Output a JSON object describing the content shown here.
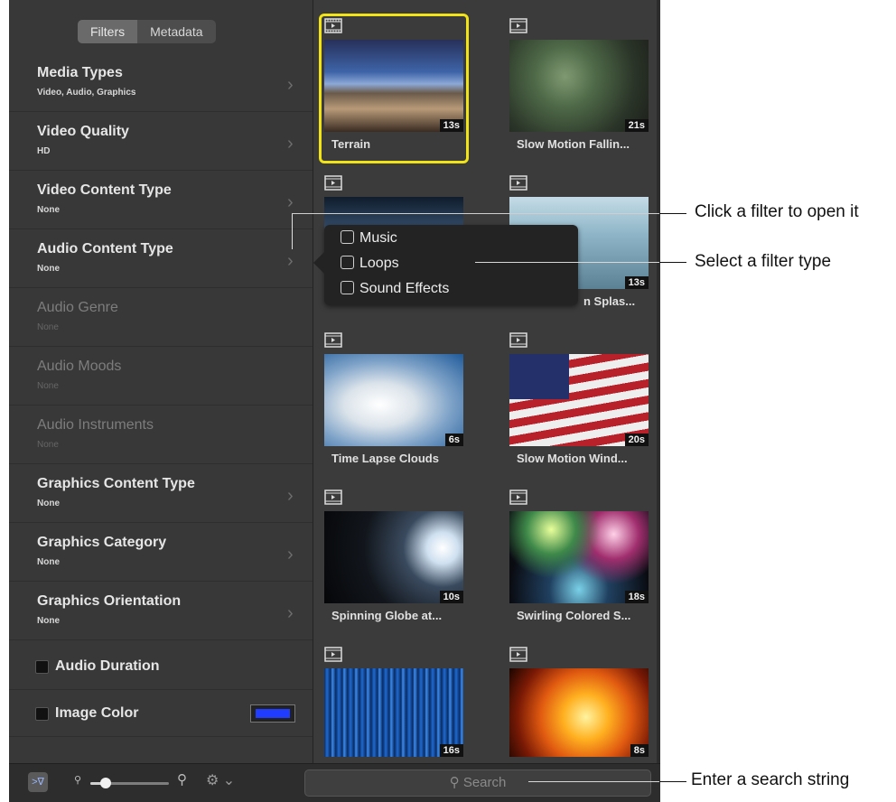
{
  "sidebar": {
    "tabs": [
      "Filters",
      "Metadata"
    ],
    "filters": [
      {
        "title": "Media Types",
        "subtitle": "Video, Audio, Graphics",
        "enabled": true
      },
      {
        "title": "Video Quality",
        "subtitle": "HD",
        "enabled": true
      },
      {
        "title": "Video Content Type",
        "subtitle": "None",
        "enabled": true
      },
      {
        "title": "Audio Content Type",
        "subtitle": "None",
        "enabled": true
      },
      {
        "title": "Audio Genre",
        "subtitle": "None",
        "enabled": false
      },
      {
        "title": "Audio Moods",
        "subtitle": "None",
        "enabled": false
      },
      {
        "title": "Audio Instruments",
        "subtitle": "None",
        "enabled": false
      },
      {
        "title": "Graphics Content Type",
        "subtitle": "None",
        "enabled": true
      },
      {
        "title": "Graphics Category",
        "subtitle": "None",
        "enabled": true
      },
      {
        "title": "Graphics Orientation",
        "subtitle": "None",
        "enabled": true
      }
    ],
    "audio_duration_label": "Audio Duration",
    "image_color_label": "Image Color",
    "image_color_value": "#1f3cff"
  },
  "popup": {
    "options": [
      "Music",
      "Loops",
      "Sound Effects"
    ]
  },
  "grid": {
    "items": [
      {
        "title": "Terrain",
        "duration": "13s",
        "selected": true
      },
      {
        "title": "Slow Motion Fallin...",
        "duration": "21s"
      },
      {
        "title": "",
        "duration": ""
      },
      {
        "title": "n Splas...",
        "duration": "13s"
      },
      {
        "title": "Time Lapse Clouds",
        "duration": "6s"
      },
      {
        "title": "Slow Motion Wind...",
        "duration": "20s"
      },
      {
        "title": "Spinning Globe at...",
        "duration": "10s"
      },
      {
        "title": "Swirling Colored S...",
        "duration": "18s"
      },
      {
        "title": "",
        "duration": "16s"
      },
      {
        "title": "",
        "duration": "8s"
      }
    ]
  },
  "toolbar": {
    "search_placeholder": "Search",
    "zoom_level": 0.2
  },
  "callouts": {
    "filter": "Click a filter to open it",
    "type": "Select a filter type",
    "search": "Enter a search string"
  },
  "colors": {
    "selection": "#f2e317",
    "panel": "#3b3b3b"
  }
}
